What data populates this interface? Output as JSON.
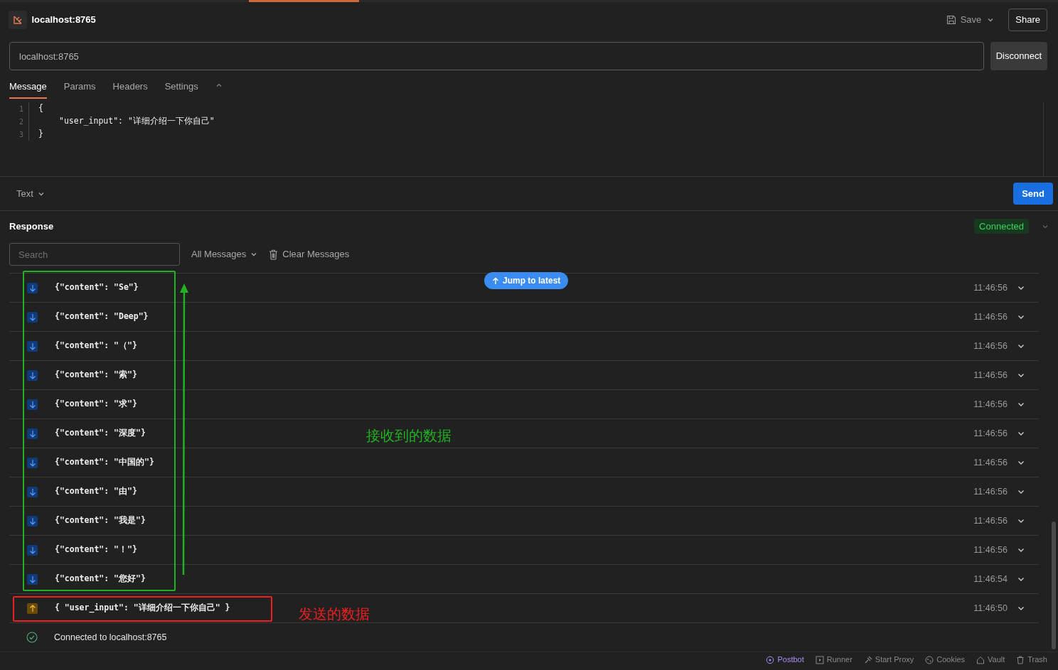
{
  "window": {
    "title": "localhost:8765"
  },
  "header": {
    "save": "Save",
    "share": "Share"
  },
  "url": {
    "value": "localhost:8765",
    "button": "Disconnect"
  },
  "tabs": [
    {
      "label": "Message",
      "selected": true
    },
    {
      "label": "Params",
      "selected": false
    },
    {
      "label": "Headers",
      "selected": false
    },
    {
      "label": "Settings",
      "selected": false
    }
  ],
  "editor": {
    "lines": [
      {
        "number": "1",
        "text": "{"
      },
      {
        "number": "2",
        "text": "\"user_input\": \"详细介绍一下你自己\""
      },
      {
        "number": "3",
        "text": "}"
      }
    ]
  },
  "body_format": "Text",
  "send": "Send",
  "response": {
    "title": "Response",
    "status": "Connected",
    "search": {
      "placeholder": "Search"
    },
    "filter": "All Messages",
    "clear": "Clear Messages",
    "jump": "Jump to latest",
    "messages": [
      {
        "kind": "received",
        "text": "{\"content\": \"Se\"}",
        "time": "11:46:56"
      },
      {
        "kind": "received",
        "text": "{\"content\": \"Deep\"}",
        "time": "11:46:56"
      },
      {
        "kind": "received",
        "text": "{\"content\": \"（\"}",
        "time": "11:46:56"
      },
      {
        "kind": "received",
        "text": "{\"content\": \"索\"}",
        "time": "11:46:56"
      },
      {
        "kind": "received",
        "text": "{\"content\": \"求\"}",
        "time": "11:46:56"
      },
      {
        "kind": "received",
        "text": "{\"content\": \"深度\"}",
        "time": "11:46:56"
      },
      {
        "kind": "received",
        "text": "{\"content\": \"中国的\"}",
        "time": "11:46:56"
      },
      {
        "kind": "received",
        "text": "{\"content\": \"由\"}",
        "time": "11:46:56"
      },
      {
        "kind": "received",
        "text": "{\"content\": \"我是\"}",
        "time": "11:46:56"
      },
      {
        "kind": "received",
        "text": "{\"content\": \"！\"}",
        "time": "11:46:56"
      },
      {
        "kind": "received",
        "text": "{\"content\": \"您好\"}",
        "time": "11:46:54"
      },
      {
        "kind": "sent",
        "text": "{ \"user_input\": \"详细介绍一下你自己\" }",
        "time": "11:46:50"
      },
      {
        "kind": "event",
        "text": "Connected to localhost:8765"
      }
    ]
  },
  "annotations": [
    {
      "kind": "received",
      "label": "接收到的数据",
      "color": "#22b122"
    },
    {
      "kind": "sent",
      "label": "发送的数据",
      "color": "#ee2020"
    }
  ],
  "status_bar": [
    {
      "kind": "postbot",
      "label": "Postbot"
    },
    {
      "kind": "runner",
      "label": "Runner"
    },
    {
      "kind": "proxy",
      "label": "Start Proxy"
    },
    {
      "kind": "cookies",
      "label": "Cookies"
    },
    {
      "kind": "vault",
      "label": "Vault"
    },
    {
      "kind": "trash",
      "label": "Trash"
    }
  ]
}
